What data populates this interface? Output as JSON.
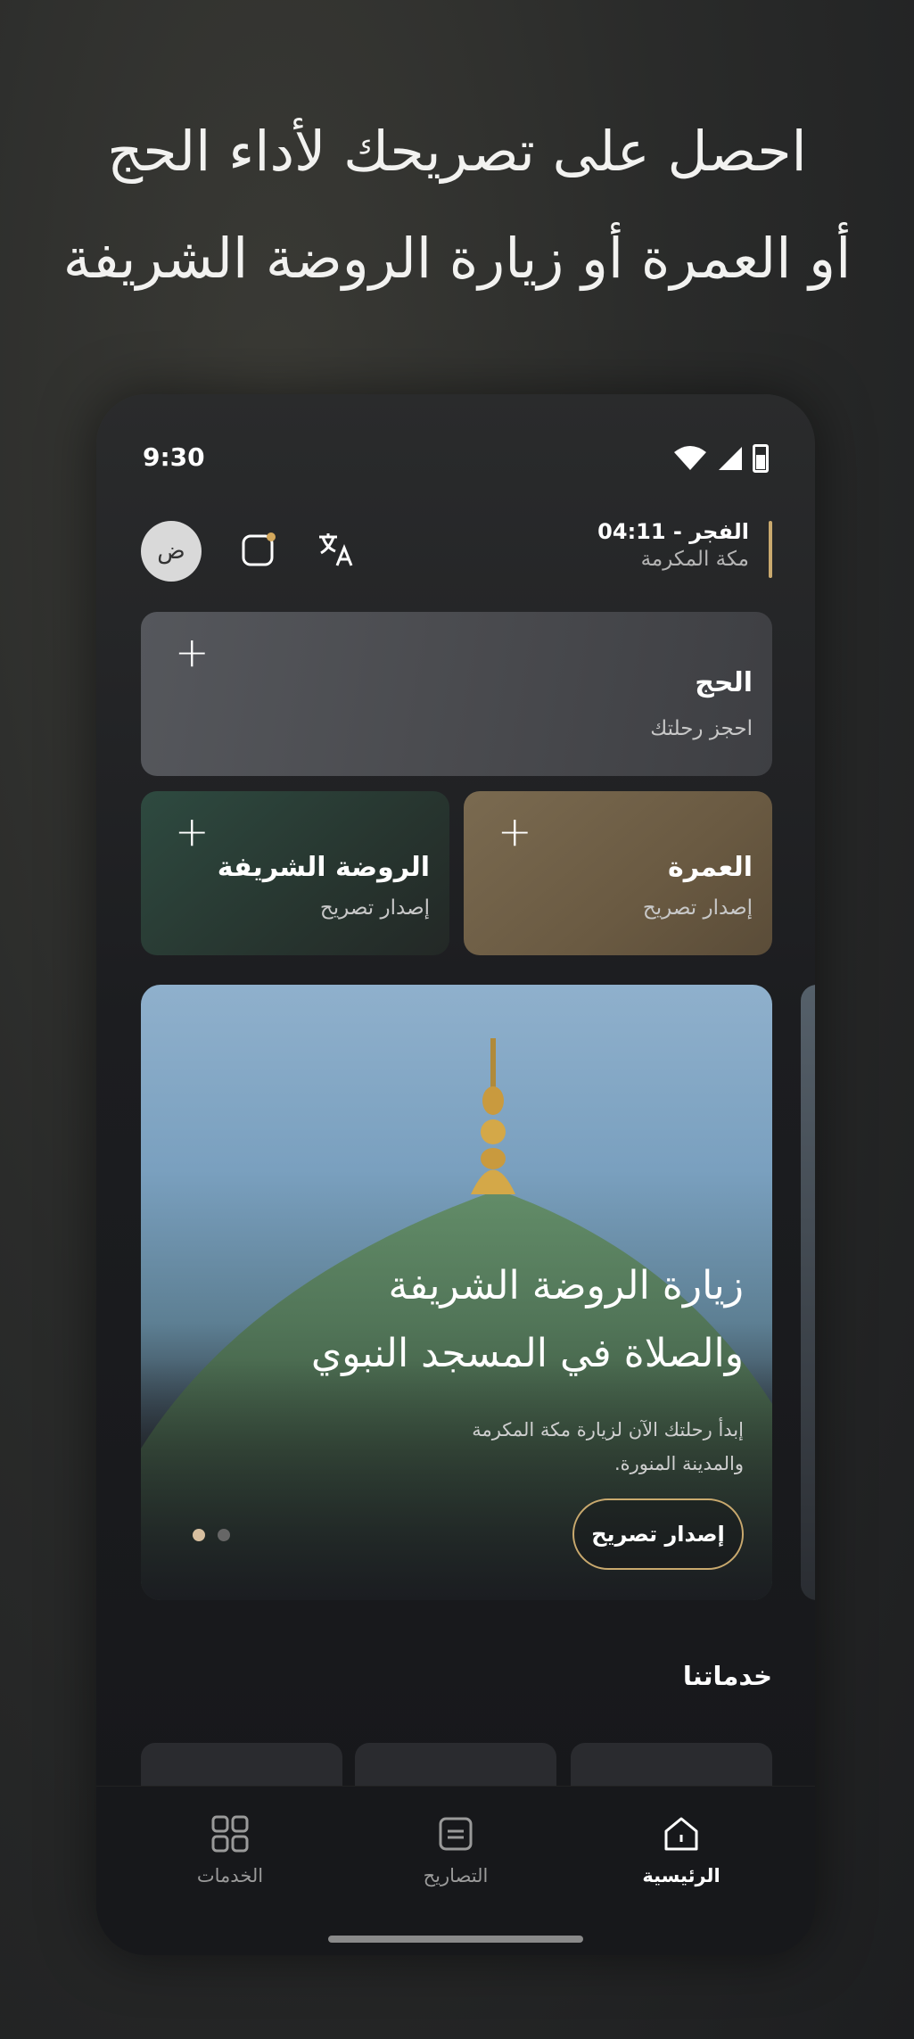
{
  "promo": {
    "line1": "احصل على تصريحك لأداء الحج",
    "line2": "أو العمرة أو زيارة الروضة الشريفة"
  },
  "status_bar": {
    "time": "9:30"
  },
  "header": {
    "avatar_letter": "ض",
    "prayer_time": "الفجر - 04:11",
    "city": "مكة المكرمة"
  },
  "cards": {
    "hajj": {
      "title": "الحج",
      "subtitle": "احجز رحلتك"
    },
    "umrah": {
      "title": "العمرة",
      "subtitle": "إصدار تصريح"
    },
    "rawdah": {
      "title": "الروضة الشريفة",
      "subtitle": "إصدار تصريح"
    }
  },
  "hero": {
    "title_line1": "زيارة الروضة الشريفة",
    "title_line2": "والصلاة في المسجد النبوي",
    "desc_line1": "إبدأ رحلتك الآن لزيارة مكة المكرمة",
    "desc_line2": "والمدينة المنورة.",
    "button": "إصدار تصريح",
    "carousel_index": 1,
    "carousel_count": 2
  },
  "services": {
    "title": "خدماتنا"
  },
  "bottom_nav": {
    "home": "الرئيسية",
    "permits": "التصاريح",
    "services": "الخدمات",
    "active": "home"
  },
  "colors": {
    "accent_gold": "#c9a96e",
    "umrah_card": "#6a5a42",
    "rawdah_card": "#27352f",
    "hajj_card": "#4a4b4f"
  }
}
